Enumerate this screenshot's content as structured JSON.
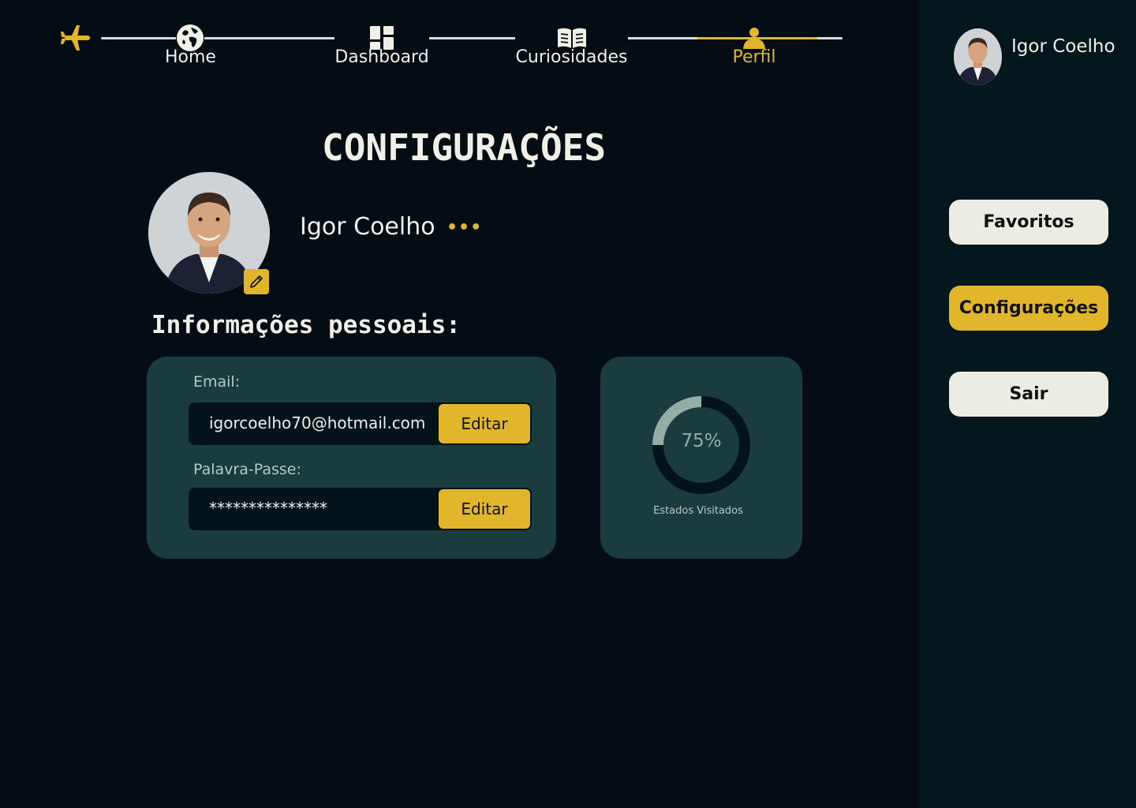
{
  "nav": {
    "items": [
      {
        "label": "Home",
        "icon": "globe-icon"
      },
      {
        "label": "Dashboard",
        "icon": "dashboard-grid-icon"
      },
      {
        "label": "Curiosidades",
        "icon": "open-book-icon"
      },
      {
        "label": "Perfil",
        "icon": "user-icon",
        "active": true
      }
    ],
    "logo_icon": "airplane-icon"
  },
  "page": {
    "title": "CONFIGURAÇÕES"
  },
  "profile": {
    "name": "Igor Coelho",
    "more_label": "•••"
  },
  "personal_info": {
    "title": "Informações pessoais:",
    "email": {
      "label": "Email:",
      "value": "igorcoelho70@hotmail.com",
      "button": "Editar"
    },
    "password": {
      "label": "Palavra-Passe:",
      "value": "***************",
      "button": "Editar"
    }
  },
  "stats": {
    "percent_label": "75%",
    "percent": 75,
    "caption": "Estados Visitados"
  },
  "sidebar": {
    "user_name": "Igor Coelho",
    "buttons": [
      {
        "label": "Favoritos",
        "active": false
      },
      {
        "label": "Configurações",
        "active": true
      },
      {
        "label": "Sair",
        "active": false
      }
    ]
  },
  "colors": {
    "background": "#040d14",
    "sidebar": "#03171c",
    "card": "#1a3c3c",
    "accent": "#e1b62b",
    "text": "#f0efe8"
  }
}
